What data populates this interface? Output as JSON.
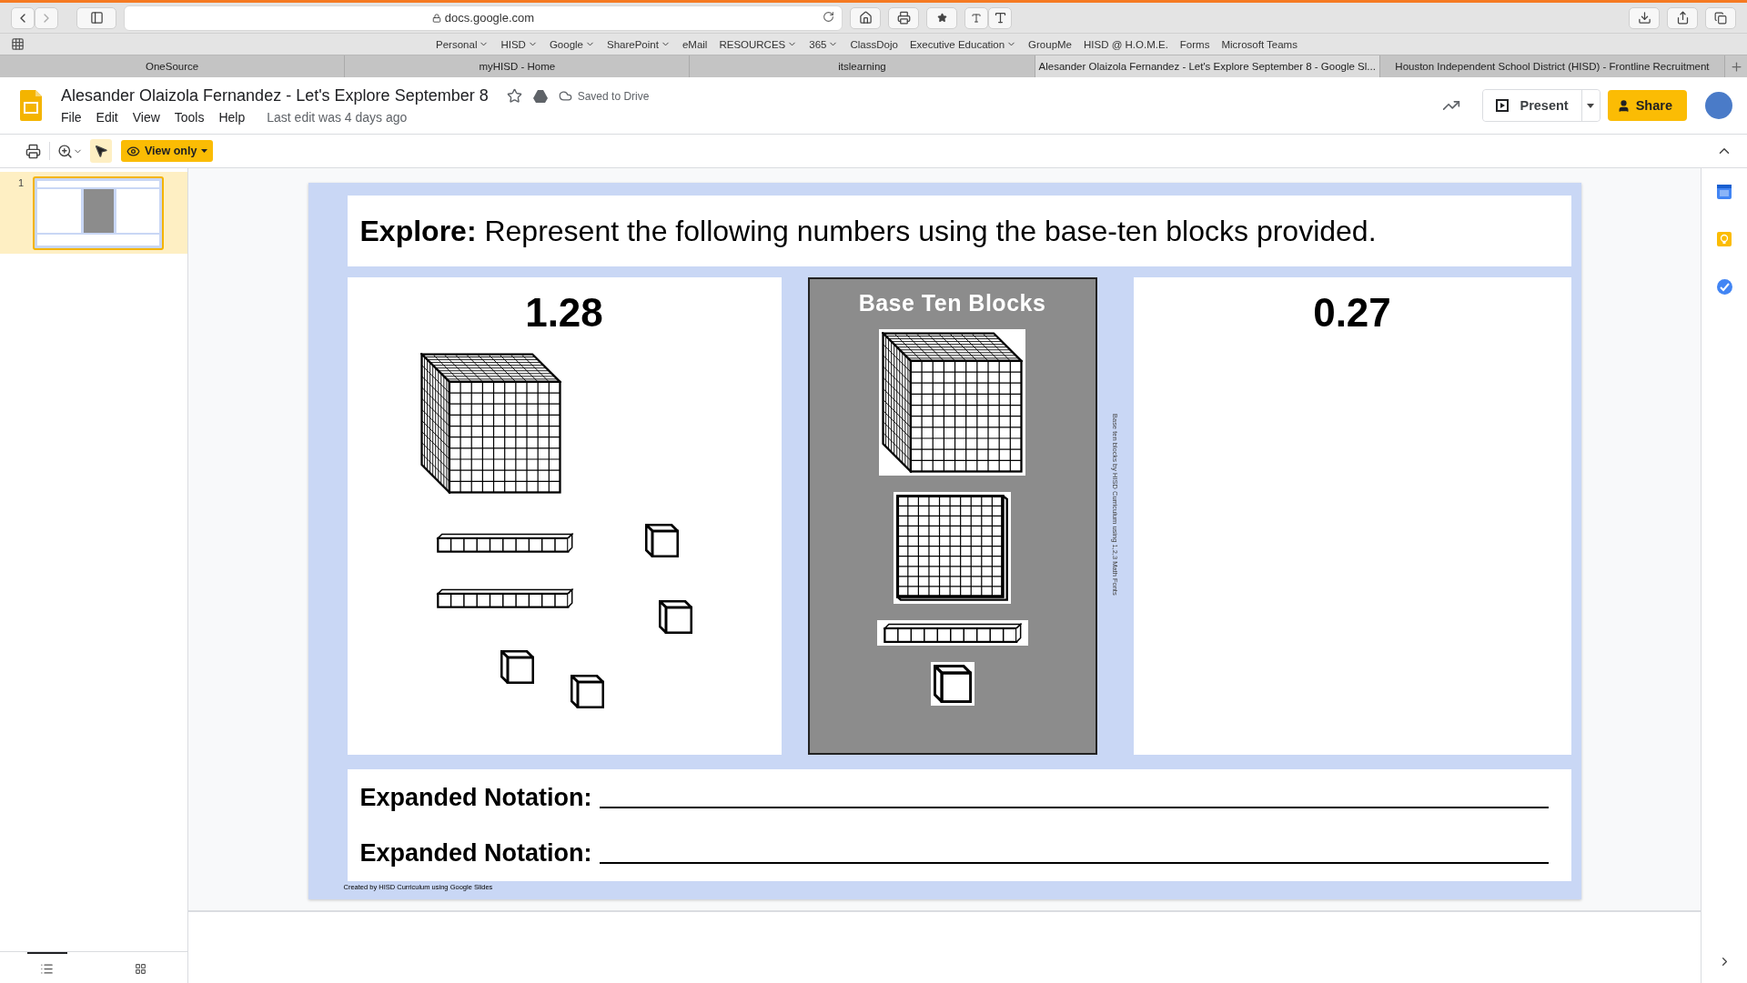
{
  "browser": {
    "address": "docs.google.com",
    "bookmarks": [
      {
        "label": "Personal",
        "dropdown": true
      },
      {
        "label": "HISD",
        "dropdown": true
      },
      {
        "label": "Google",
        "dropdown": true
      },
      {
        "label": "SharePoint",
        "dropdown": true
      },
      {
        "label": "eMail",
        "dropdown": false
      },
      {
        "label": "RESOURCES",
        "dropdown": true
      },
      {
        "label": "365",
        "dropdown": true
      },
      {
        "label": "ClassDojo",
        "dropdown": false
      },
      {
        "label": "Executive Education",
        "dropdown": true
      },
      {
        "label": "GroupMe",
        "dropdown": false
      },
      {
        "label": "HISD @ H.O.M.E.",
        "dropdown": false
      },
      {
        "label": "Forms",
        "dropdown": false
      },
      {
        "label": "Microsoft Teams",
        "dropdown": false
      }
    ],
    "tabs": [
      {
        "label": "OneSource",
        "selected": false
      },
      {
        "label": "myHISD - Home",
        "selected": false
      },
      {
        "label": "itslearning",
        "selected": false
      },
      {
        "label": "Alesander Olaizola Fernandez - Let's Explore September 8 - Google Sl...",
        "selected": true
      },
      {
        "label": "Houston Independent School District (HISD) - Frontline Recruitment",
        "selected": false
      }
    ]
  },
  "document": {
    "title": "Alesander Olaizola Fernandez - Let's Explore September 8",
    "starred": false,
    "save_status": "Saved to Drive",
    "menu": [
      "File",
      "Edit",
      "View",
      "Tools",
      "Help"
    ],
    "last_edit": "Last edit was 4 days ago",
    "present": "Present",
    "share": "Share"
  },
  "toolbar": {
    "tools": [
      {
        "kind": "print",
        "selected": false
      },
      {
        "kind": "zoom",
        "selected": false
      },
      {
        "kind": "pointer",
        "selected": true
      }
    ],
    "mode": "View only"
  },
  "filmstrip": {
    "slides": [
      {
        "number": "1",
        "selected": true
      }
    ]
  },
  "slide": {
    "heading": "**Explore:** Represent the following numbers using the base-ten blocks provided.",
    "left_panel": {
      "number": "1.28",
      "blocks": [
        {
          "kind": "cube"
        },
        {
          "kind": "rod"
        },
        {
          "kind": "rod"
        },
        {
          "kind": "unit"
        },
        {
          "kind": "unit"
        },
        {
          "kind": "unit"
        },
        {
          "kind": "unit"
        }
      ]
    },
    "reference_panel": {
      "title": "Base Ten Blocks",
      "blocks": [
        {
          "kind": "cube"
        },
        {
          "kind": "flat"
        },
        {
          "kind": "rod"
        },
        {
          "kind": "unit"
        }
      ]
    },
    "side_credit": "Base ten blocks by HISD Curriculum using 1,2,3 Math Fonts",
    "right_panel": {
      "number": "0.27"
    },
    "notation_lines": [
      "Expanded Notation:",
      "Expanded Notation:"
    ],
    "credit": "Created by HISD Curriculum using Google Slides"
  }
}
